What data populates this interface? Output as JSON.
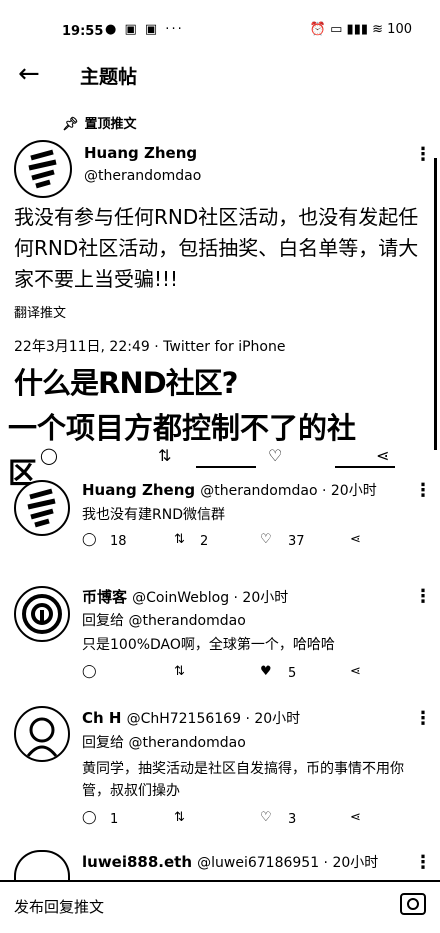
{
  "status_bar": {
    "time": "19:55",
    "left_icons": "● ▣ ▣ ···",
    "right_icons": "⏰ ▭ ▮▮▮ ≋ 100"
  },
  "header": {
    "title": "主题帖"
  },
  "pinned_label": "置顶推文",
  "main_tweet": {
    "author": "Huang Zheng",
    "handle": "@therandomdao",
    "body": "我没有参与任何RND社区活动，也没有发起任何RND社区活动，包括抽奖、白名单等，请大家不要上当受骗!!!",
    "translate": "翻译推文",
    "meta": "22年3月11日, 22:49 · Twitter for iPhone"
  },
  "overlay": {
    "line1": "什么是RND社区?",
    "line2": "一个项目方都控制不了的社",
    "line3": "区"
  },
  "replies": [
    {
      "author": "Huang Zheng",
      "handle": "@therandomdao · 20小时",
      "replying_to": "",
      "text": "我也没有建RND微信群",
      "replies": "18",
      "retweets": "2",
      "likes": "37"
    },
    {
      "author": "币博客",
      "handle": "@CoinWeblog · 20小时",
      "replying_to": "回复给 @therandomdao",
      "text": "只是100%DAO啊，全球第一个，哈哈哈",
      "replies": "",
      "retweets": "",
      "likes": "5"
    },
    {
      "author": "Ch H",
      "handle": "@ChH72156169 · 20小时",
      "replying_to": "回复给 @therandomdao",
      "text": "黄同学，抽奖活动是社区自发搞得，币的事情不用你管，叔叔们操办",
      "replies": "1",
      "retweets": "",
      "likes": "3"
    },
    {
      "author": "luwei888.eth",
      "handle": "@luwei67186951 · 20小时",
      "replying_to": "",
      "text": "",
      "replies": "",
      "retweets": "",
      "likes": ""
    }
  ],
  "bottom_bar": {
    "reply_label": "发布回复推文"
  }
}
